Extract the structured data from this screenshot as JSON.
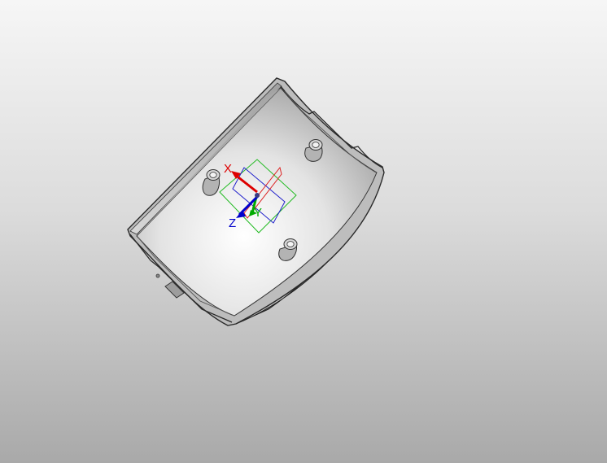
{
  "viewport": {
    "background_top": "#f6f6f6",
    "background_bottom": "#a9a9a9"
  },
  "part": {
    "body_color": "#c9c9c9",
    "edge_color": "#333333",
    "boss_count": 3
  },
  "triad": {
    "x_label": "X",
    "y_label": "Y",
    "z_label": "Z",
    "x_color": "#e00000",
    "y_color": "#00b000",
    "z_color": "#0000e0"
  }
}
